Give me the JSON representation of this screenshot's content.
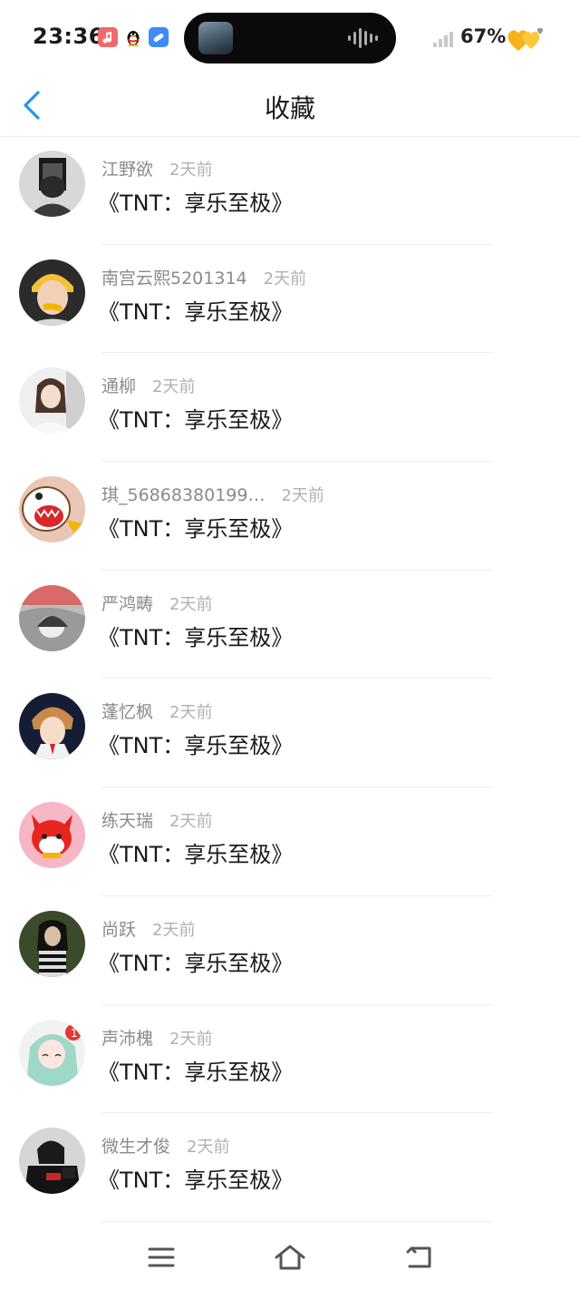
{
  "status_bar": {
    "time": "23:36",
    "battery": "67%",
    "icons": [
      "music-app-icon",
      "qq-penguin-icon",
      "blue-app-icon",
      "signal-icon",
      "hearts-battery-icon"
    ]
  },
  "header": {
    "title": "收藏",
    "back_icon": "chevron-left-icon"
  },
  "favorites": [
    {
      "name": "江野欲",
      "time": "2天前",
      "title": "《TNT：享乐至极》"
    },
    {
      "name": "南宫云熙5201314",
      "time": "2天前",
      "title": "《TNT：享乐至极》"
    },
    {
      "name": "通柳",
      "time": "2天前",
      "title": "《TNT：享乐至极》"
    },
    {
      "name": "琪_56868380199…",
      "time": "2天前",
      "title": "《TNT：享乐至极》"
    },
    {
      "name": "严鸿畴",
      "time": "2天前",
      "title": "《TNT：享乐至极》"
    },
    {
      "name": "蓬忆枫",
      "time": "2天前",
      "title": "《TNT：享乐至极》"
    },
    {
      "name": "练天瑞",
      "time": "2天前",
      "title": "《TNT：享乐至极》"
    },
    {
      "name": "尚跃",
      "time": "2天前",
      "title": "《TNT：享乐至极》"
    },
    {
      "name": "声沛槐",
      "time": "2天前",
      "title": "《TNT：享乐至极》"
    },
    {
      "name": "微生才俊",
      "time": "2天前",
      "title": "《TNT：享乐至极》"
    }
  ],
  "nav": {
    "icons": [
      "menu-icon",
      "home-icon",
      "back-icon"
    ]
  },
  "colors": {
    "accent": "#2196f3",
    "name_gray": "#8a8a8a",
    "time_gray": "#b0b0b0",
    "title_text": "#1a1a1a"
  }
}
